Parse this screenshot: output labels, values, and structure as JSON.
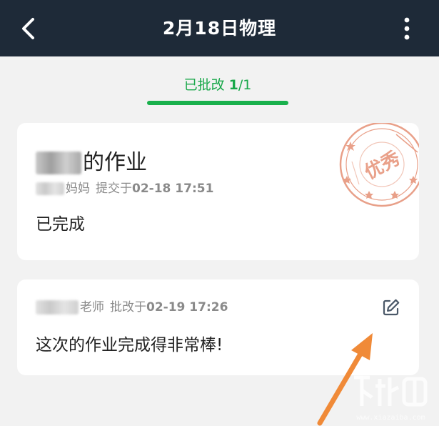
{
  "header": {
    "title": "2月18日物理",
    "back_icon": "chevron-left-icon",
    "more_icon": "more-vertical-icon",
    "background": "#1e2a38"
  },
  "tabs": {
    "active": {
      "label": "已批改 ",
      "count": "1",
      "total": "/1"
    },
    "accent": "#19b04c"
  },
  "homework": {
    "title_suffix": "的作业",
    "submitter": "妈妈",
    "submit_action": "提交于",
    "submit_time": "02-18 17:51",
    "status": "已完成",
    "stamp_text": "优秀",
    "stamp_color": "#e59075"
  },
  "review": {
    "reviewer": "老师",
    "review_action": "批改于",
    "review_time": "02-19 17:26",
    "comment": "这次的作业完成得非常棒!",
    "edit_icon": "edit-icon",
    "annotation_arrow_color": "#f08a38"
  },
  "watermark": {
    "text": "www.xiazaiba.com"
  }
}
